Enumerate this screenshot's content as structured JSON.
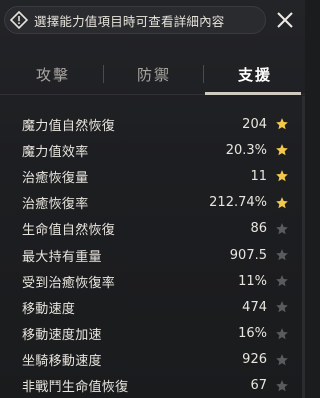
{
  "header": {
    "notice_text": "選擇能力值項目時可查看詳細內容",
    "warning_icon": "warning-diamond-icon",
    "close_icon": "close-icon"
  },
  "tabs": [
    {
      "label": "攻擊",
      "active": false
    },
    {
      "label": "防禦",
      "active": false
    },
    {
      "label": "支援",
      "active": true
    }
  ],
  "colors": {
    "star_active": "#f2c94c",
    "star_inactive": "#5a5b5f"
  },
  "stats": [
    {
      "label": "魔力值自然恢復",
      "value": "204",
      "starred": true
    },
    {
      "label": "魔力值效率",
      "value": "20.3%",
      "starred": true
    },
    {
      "label": "治癒恢復量",
      "value": "11",
      "starred": true
    },
    {
      "label": "治癒恢復率",
      "value": "212.74%",
      "starred": true
    },
    {
      "label": "生命值自然恢復",
      "value": "86",
      "starred": false
    },
    {
      "label": "最大持有重量",
      "value": "907.5",
      "starred": false
    },
    {
      "label": "受到治癒恢復率",
      "value": "11%",
      "starred": false
    },
    {
      "label": "移動速度",
      "value": "474",
      "starred": false
    },
    {
      "label": "移動速度加速",
      "value": "16%",
      "starred": false
    },
    {
      "label": "坐騎移動速度",
      "value": "926",
      "starred": false
    },
    {
      "label": "非戰鬥生命值恢復",
      "value": "67",
      "starred": false
    }
  ]
}
